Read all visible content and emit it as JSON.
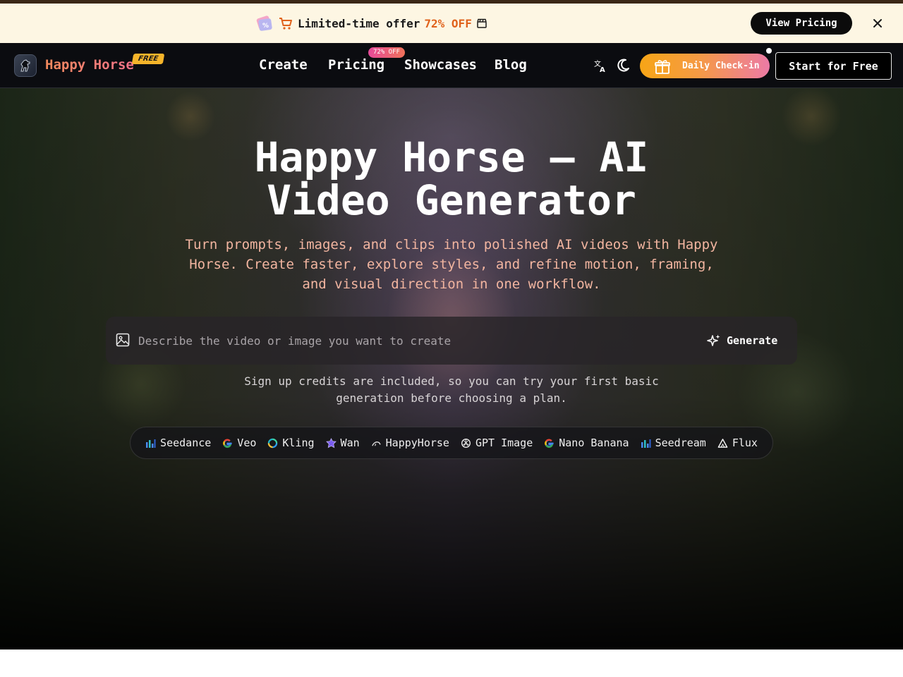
{
  "promo": {
    "text": "Limited-time offer",
    "percent": "72% OFF",
    "cta": "View Pricing"
  },
  "nav": {
    "brand": "Happy Horse",
    "free_tag": "FREE",
    "links": [
      "Create",
      "Pricing",
      "Showcases",
      "Blog"
    ],
    "pricing_badge": "72% OFF",
    "checkin_label": "Daily Check-in",
    "start_label": "Start for Free"
  },
  "hero": {
    "title_line1": "Happy Horse – AI",
    "title_line2": "Video Generator",
    "subtitle": "Turn prompts, images, and clips into polished AI videos with Happy Horse. Create faster, explore styles, and refine motion, framing, and visual direction in one workflow.",
    "prompt_placeholder": "Describe the video or image you want to create",
    "generate_label": "Generate",
    "signup_note": "Sign up credits are included, so you can try your first basic generation before choosing a plan."
  },
  "models": [
    {
      "name": "Seedance",
      "icon": "bars-chart-icon"
    },
    {
      "name": "Veo",
      "icon": "google-g-icon"
    },
    {
      "name": "Kling",
      "icon": "kling-swirl-icon"
    },
    {
      "name": "Wan",
      "icon": "wan-star-icon"
    },
    {
      "name": "HappyHorse",
      "icon": "horse-icon"
    },
    {
      "name": "GPT Image",
      "icon": "openai-knot-icon"
    },
    {
      "name": "Nano Banana",
      "icon": "google-g-icon"
    },
    {
      "name": "Seedream",
      "icon": "bars-chart-icon"
    },
    {
      "name": "Flux",
      "icon": "triangle-icon"
    }
  ],
  "colors": {
    "promo_bg": "#fdf6e3",
    "promo_accent": "#e0621c",
    "nav_bg": "#0b0c10",
    "brand_gradient_start": "#f28a5d",
    "brand_gradient_end": "#f3728a",
    "checkin_gradient_start": "#f7a516",
    "checkin_gradient_end": "#ec7aa6",
    "subtitle": "#f2b5a0"
  }
}
